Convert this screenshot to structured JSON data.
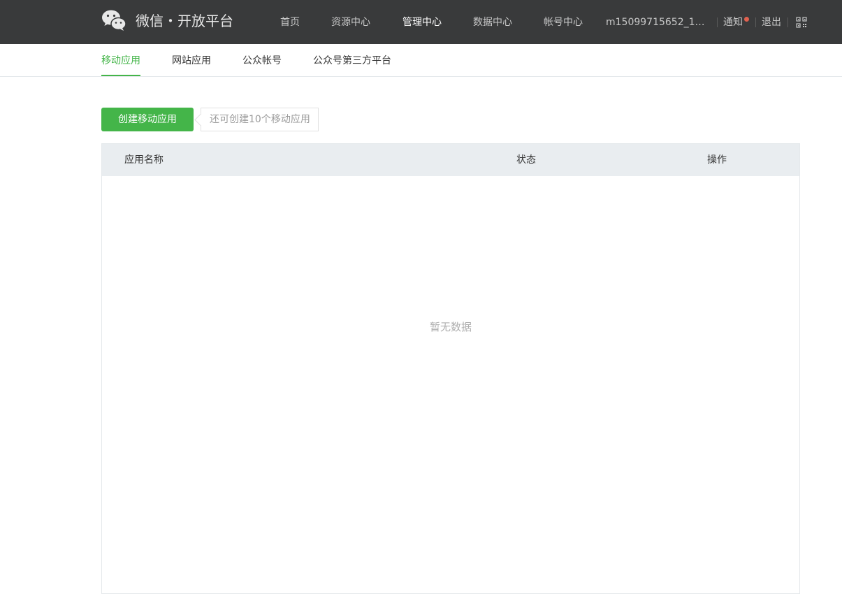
{
  "header": {
    "brand": "微信・开放平台",
    "logo_icon": "wechat-logo-icon",
    "nav": [
      {
        "label": "首页",
        "active": false
      },
      {
        "label": "资源中心",
        "active": false
      },
      {
        "label": "管理中心",
        "active": true
      },
      {
        "label": "数据中心",
        "active": false
      },
      {
        "label": "帐号中心",
        "active": false
      }
    ],
    "account": "m15099715652_1@1...",
    "notify_label": "通知",
    "logout_label": "退出",
    "qr_icon": "qr-code-icon"
  },
  "subnav": {
    "tabs": [
      {
        "label": "移动应用",
        "active": true
      },
      {
        "label": "网站应用",
        "active": false
      },
      {
        "label": "公众帐号",
        "active": false
      },
      {
        "label": "公众号第三方平台",
        "active": false
      }
    ]
  },
  "toolbar": {
    "create_label": "创建移动应用",
    "quota_tip": "还可创建10个移动应用"
  },
  "table": {
    "columns": [
      "应用名称",
      "状态",
      "操作"
    ],
    "empty_text": "暂无数据"
  },
  "colors": {
    "header_bg": "#393a3b",
    "accent": "#44b549",
    "notify_dot": "#e0614f"
  }
}
